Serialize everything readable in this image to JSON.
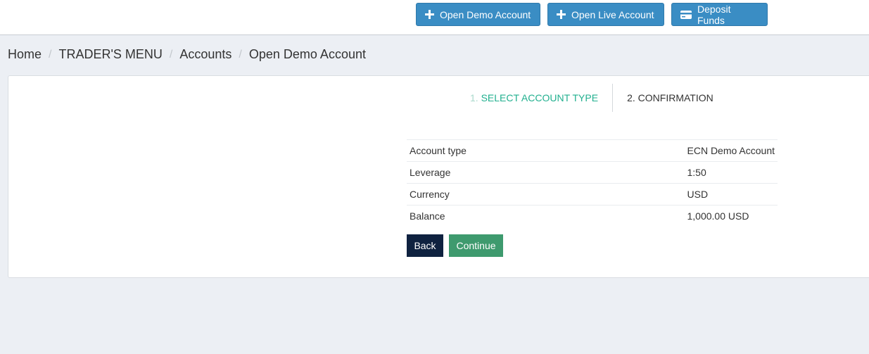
{
  "header": {
    "buttons": [
      {
        "label": "Open Demo Account",
        "icon": "plus-icon"
      },
      {
        "label": "Open Live Account",
        "icon": "plus-icon"
      },
      {
        "label": "Deposit Funds",
        "icon": "credit-card-icon"
      }
    ]
  },
  "breadcrumb": {
    "items": [
      "Home",
      "TRADER'S MENU",
      "Accounts",
      "Open Demo Account"
    ],
    "separator": "/"
  },
  "steps": {
    "step1_num": "1.",
    "step1_label": "SELECT ACCOUNT TYPE",
    "step2_num": "2.",
    "step2_label": "CONFIRMATION"
  },
  "summary": {
    "rows": [
      {
        "label": "Account type",
        "value": "ECN Demo Account"
      },
      {
        "label": "Leverage",
        "value": "1:50"
      },
      {
        "label": "Currency",
        "value": "USD"
      },
      {
        "label": "Balance",
        "value": "1,000.00 USD"
      }
    ]
  },
  "actions": {
    "back_label": "Back",
    "continue_label": "Continue"
  },
  "colors": {
    "primary_button": "#3a8dc4",
    "step_active": "#22b08f",
    "back_button": "#0f2240",
    "continue_button": "#3e9a6e",
    "page_background": "#eceff4"
  }
}
